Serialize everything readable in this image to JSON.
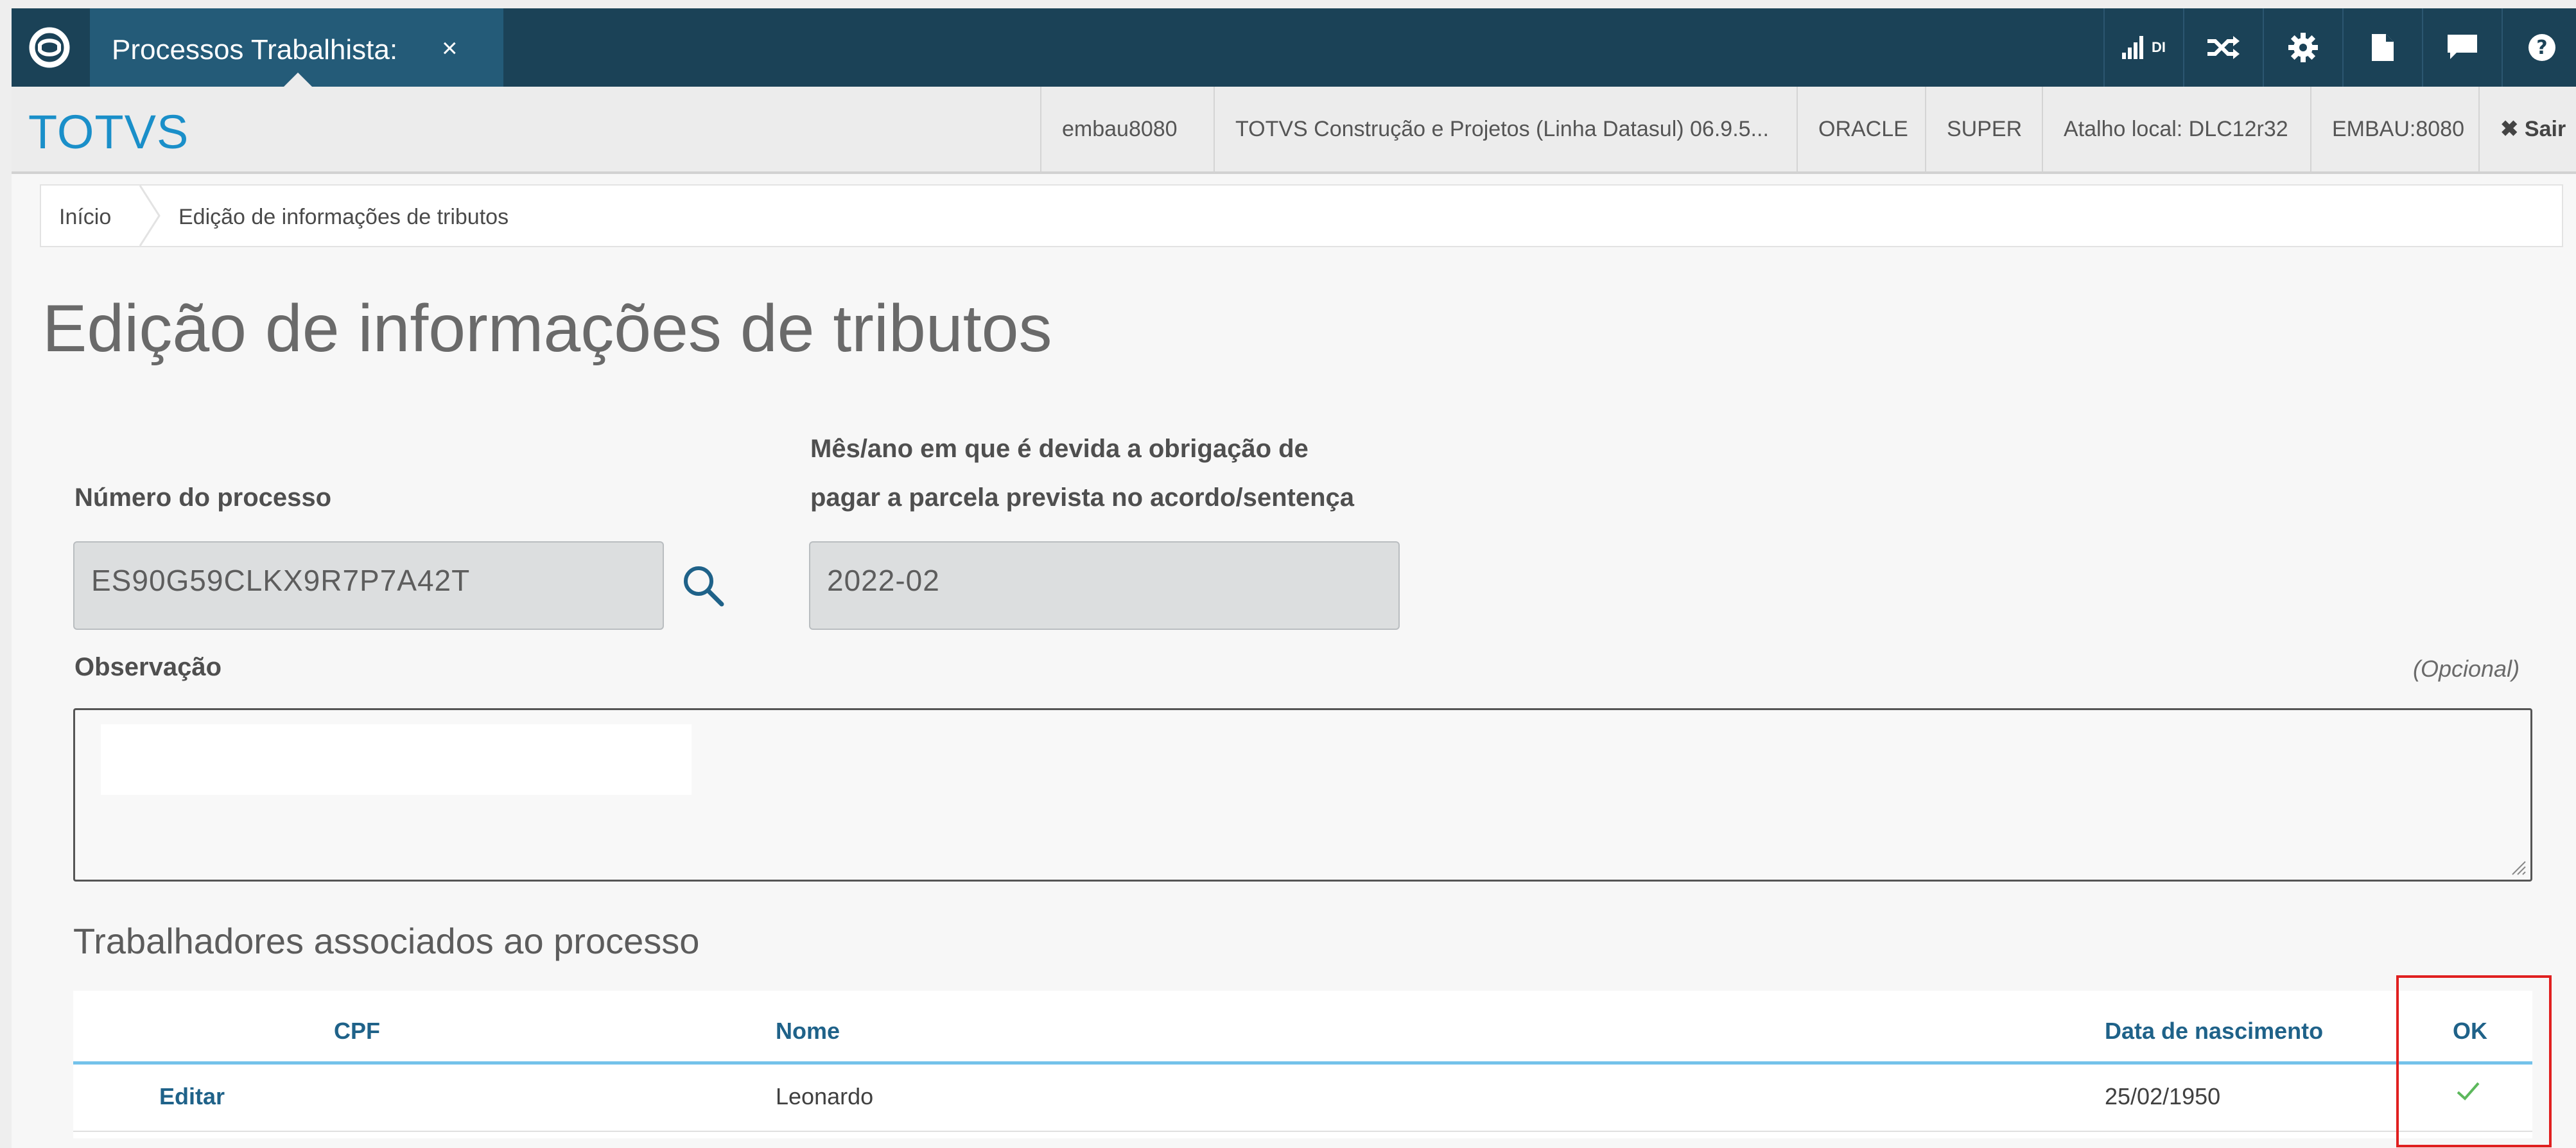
{
  "topbar": {
    "tab_label": "Processos Trabalhista:",
    "tab_close": "×",
    "icons": [
      "signal-di-icon",
      "shuffle-icon",
      "gear-icon",
      "document-icon",
      "chat-icon",
      "help-icon"
    ],
    "signal_label": "DI"
  },
  "infobar": {
    "brand": "TOTVS",
    "items": [
      "embau8080",
      "TOTVS Construção e Projetos (Linha Datasul) 06.9.5...",
      "ORACLE",
      "SUPER",
      "Atalho local: DLC12r32",
      "EMBAU:8080"
    ],
    "exit_label": "✖ Sair"
  },
  "breadcrumb": {
    "home": "Início",
    "current": "Edição de informações de tributos"
  },
  "page": {
    "title": "Edição de informações de tributos"
  },
  "form": {
    "process_label": "Número do processo",
    "process_value": "ES90G59CLKX9R7P7A42T",
    "month_label_1": "Mês/ano em que é devida a obrigação de",
    "month_label_2": "pagar a parcela prevista no acordo/sentença",
    "month_value": "2022-02",
    "obs_label": "Observação",
    "obs_optional": "(Opcional)"
  },
  "workers": {
    "title": "Trabalhadores associados ao processo",
    "columns": [
      "CPF",
      "Nome",
      "Data de nascimento",
      "OK"
    ],
    "rows": [
      {
        "action": "Editar",
        "name": "Leonardo",
        "birth": "25/02/1950",
        "ok": true
      }
    ]
  },
  "colors": {
    "topbar": "#1b4257",
    "brand": "#1a8fc9",
    "link": "#1f6289",
    "check": "#5cb85c",
    "highlight": "#e02020"
  }
}
